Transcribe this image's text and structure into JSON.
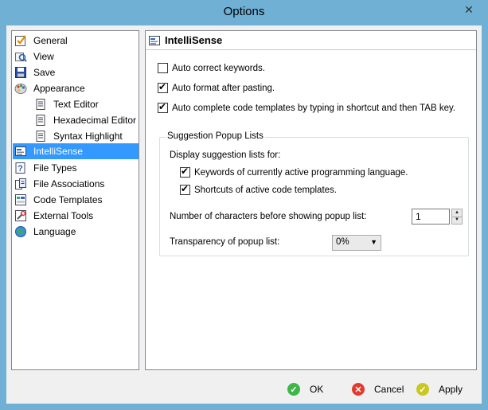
{
  "window": {
    "title": "Options",
    "close_glyph": "✕"
  },
  "sidebar": {
    "items": [
      {
        "label": "General",
        "icon": "checkbox-icon"
      },
      {
        "label": "View",
        "icon": "view-icon"
      },
      {
        "label": "Save",
        "icon": "floppy-icon"
      },
      {
        "label": "Appearance",
        "icon": "palette-icon"
      },
      {
        "label": "Text Editor",
        "icon": "document-icon"
      },
      {
        "label": "Hexadecimal Editor",
        "icon": "document-icon"
      },
      {
        "label": "Syntax Highlight",
        "icon": "document-icon"
      },
      {
        "label": "IntelliSense",
        "icon": "intellisense-icon",
        "selected": true
      },
      {
        "label": "File Types",
        "icon": "help-icon"
      },
      {
        "label": "File Associations",
        "icon": "file-assoc-icon"
      },
      {
        "label": "Code Templates",
        "icon": "code-template-icon"
      },
      {
        "label": "External Tools",
        "icon": "tools-icon"
      },
      {
        "label": "Language",
        "icon": "globe-icon"
      }
    ]
  },
  "panel": {
    "title": "IntelliSense",
    "auto_correct": {
      "label": "Auto correct keywords.",
      "checked": false
    },
    "auto_format": {
      "label": "Auto format after pasting.",
      "checked": true
    },
    "auto_complete": {
      "label": "Auto complete code templates by typing in shortcut and then TAB key.",
      "checked": true
    },
    "suggestion": {
      "legend": "Suggestion Popup Lists",
      "display_label": "Display suggestion lists for:",
      "keywords": {
        "label": "Keywords of currently active programming language.",
        "checked": true
      },
      "shortcuts": {
        "label": "Shortcuts of active code templates.",
        "checked": true
      },
      "chars_label": "Number of characters before showing popup list:",
      "chars_value": "1",
      "transparency_label": "Transparency of popup list:",
      "transparency_value": "0%"
    }
  },
  "buttons": {
    "ok": "OK",
    "cancel": "Cancel",
    "apply": "Apply"
  },
  "colors": {
    "selection": "#3399ff",
    "ok": "#3fb54a",
    "cancel": "#e23a2e",
    "apply": "#c8c820"
  }
}
